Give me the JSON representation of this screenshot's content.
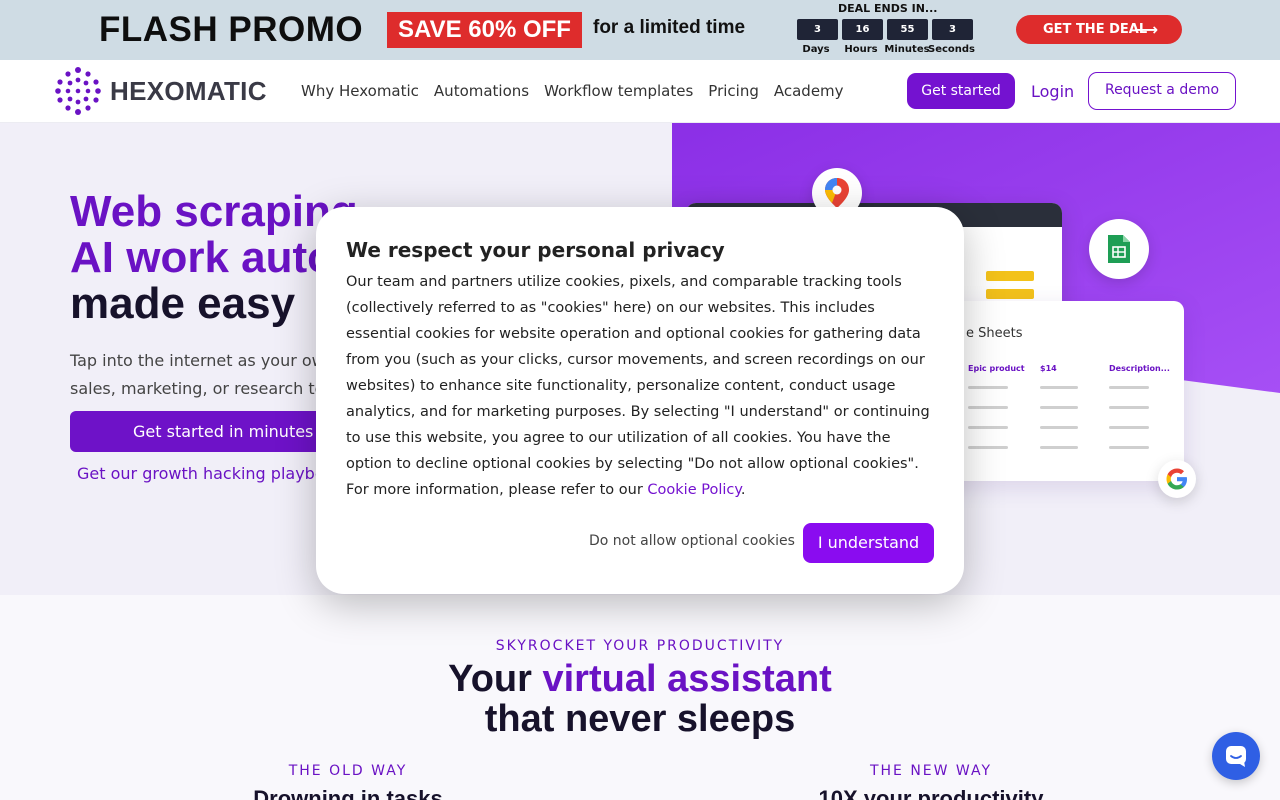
{
  "promo": {
    "title": "FLASH PROMO",
    "save": "SAVE 60% OFF",
    "limited": "for a limited time",
    "deal_ends": "DEAL ENDS IN...",
    "countdown": [
      {
        "value": "3",
        "label": "Days"
      },
      {
        "value": "16",
        "label": "Hours"
      },
      {
        "value": "55",
        "label": "Minutes"
      },
      {
        "value": "3",
        "label": "Seconds"
      }
    ],
    "cta": "GET THE DEAL",
    "accent": "#de2c2c"
  },
  "nav": {
    "logo": "HEXOMATIC",
    "links": [
      "Why Hexomatic",
      "Automations",
      "Workflow templates",
      "Pricing",
      "Academy"
    ],
    "get_started": "Get started",
    "login": "Login",
    "request_demo": "Request a demo",
    "brand_color": "#7412d0"
  },
  "hero": {
    "line1": "Web scraping",
    "line2": "AI work auto",
    "line3": "made easy",
    "subtitle": "Tap into the internet as your ow",
    "subtitle2": "sales, marketing, or research to",
    "cta": "Get started in minutes",
    "playbook": "Get our growth hacking playbo",
    "mock_sheet_title": "e Sheets",
    "mock_cols": [
      "Epic product",
      "$14",
      "Description..."
    ]
  },
  "section": {
    "eyebrow": "SKYROCKET YOUR PRODUCTIVITY",
    "title_pre": "Your ",
    "title_highlight": "virtual assistant",
    "title_line2": "that never sleeps",
    "old_way": "THE OLD WAY",
    "old_way_sub": "Drowning in tasks",
    "new_way": "THE NEW WAY",
    "new_way_sub": "10X your productivity"
  },
  "cookie_modal": {
    "title": "We respect your personal privacy",
    "body": "Our team and partners utilize cookies, pixels, and comparable tracking tools (collectively referred to as \"cookies\" here) on our websites. This includes essential cookies for website operation and optional cookies for gathering data from you (such as your clicks, cursor movements, and screen recordings on our websites) to enhance site functionality, personalize content, conduct usage analytics, and for marketing purposes. By selecting \"I understand\" or continuing to use this website, you agree to our utilization of all cookies. You have the option to decline optional cookies by selecting \"Do not allow optional cookies\".",
    "more_prefix": "For more information, please refer to our ",
    "policy_link": "Cookie Policy",
    "more_suffix": ".",
    "decline": "Do not allow optional cookies",
    "accept": "I understand"
  },
  "icons": {
    "chat": "chat-icon",
    "maps": "google-maps-icon",
    "sheets": "google-sheets-icon",
    "google": "google-icon"
  }
}
